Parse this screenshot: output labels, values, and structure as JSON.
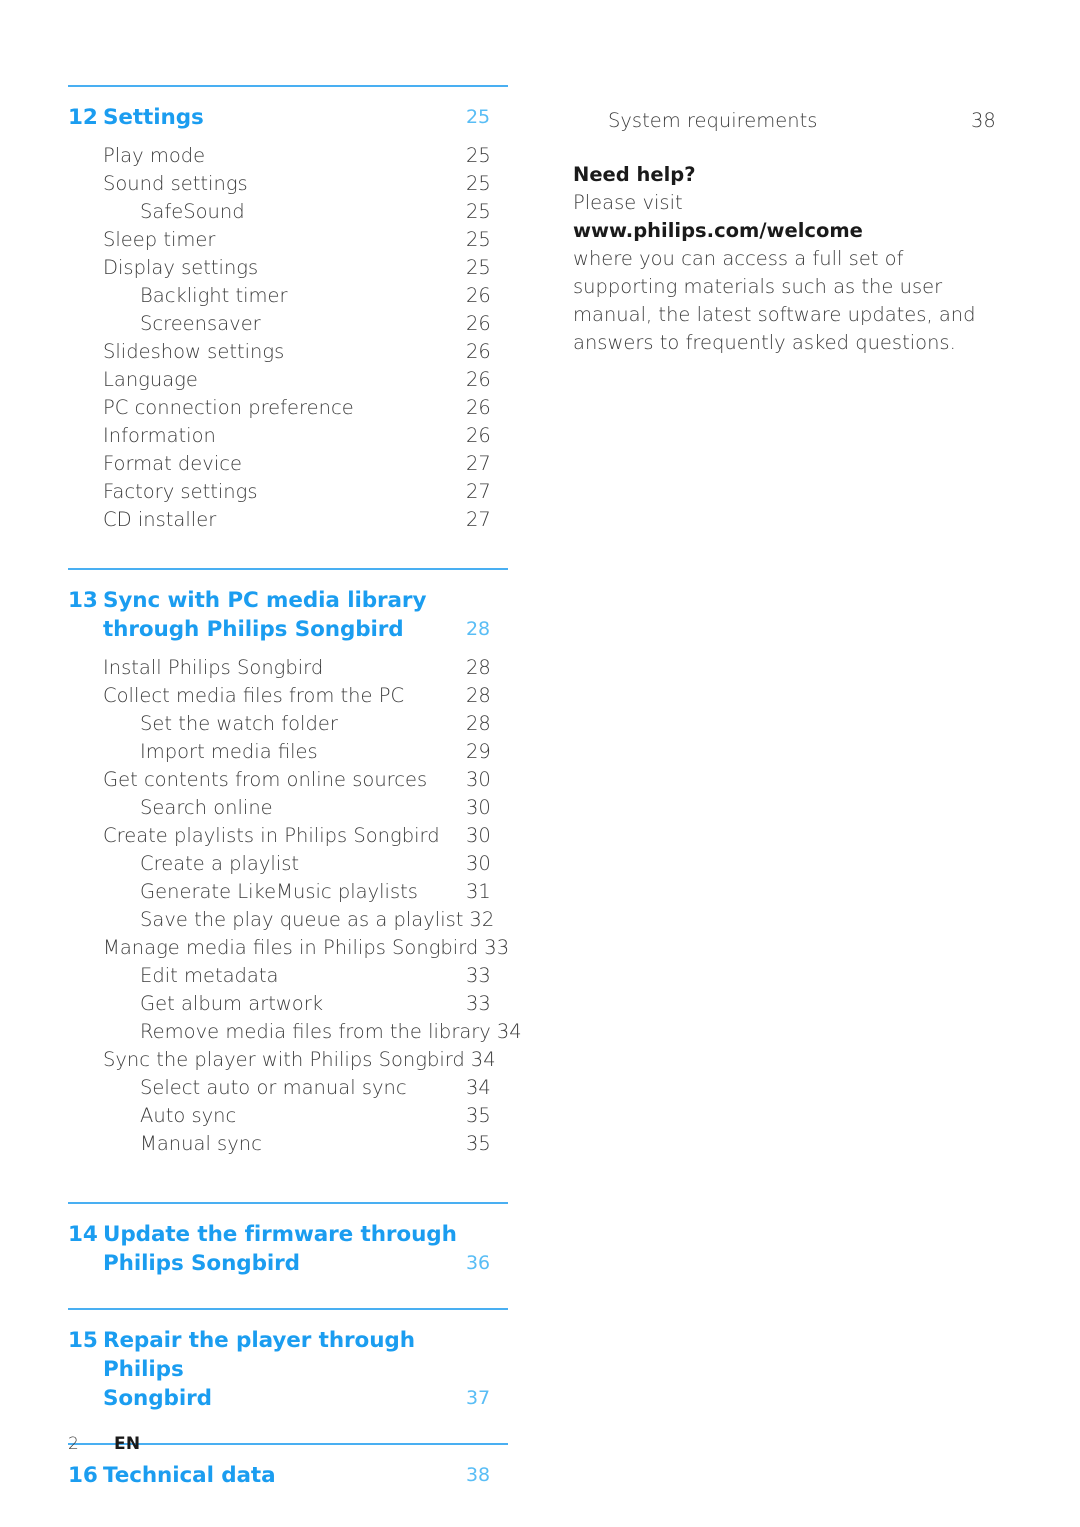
{
  "document": {
    "type": "table-of-contents",
    "language": "EN",
    "page_number": "2"
  },
  "colors": {
    "heading_blue": "#1b9df0",
    "page_number_blue": "#59bdf5",
    "rule_blue": "#49aff2",
    "body_gray": "#3b3b3b"
  },
  "left_column": {
    "sections": [
      {
        "number": "12",
        "title": "Settings",
        "title_line2": "",
        "page": "25",
        "entries": [
          {
            "level": 1,
            "label": "Play mode",
            "page": "25"
          },
          {
            "level": 1,
            "label": "Sound settings",
            "page": "25"
          },
          {
            "level": 2,
            "label": "SafeSound",
            "page": "25"
          },
          {
            "level": 1,
            "label": "Sleep timer",
            "page": "25"
          },
          {
            "level": 1,
            "label": "Display settings",
            "page": "25"
          },
          {
            "level": 2,
            "label": "Backlight timer",
            "page": "26"
          },
          {
            "level": 2,
            "label": "Screensaver",
            "page": "26"
          },
          {
            "level": 1,
            "label": "Slideshow settings",
            "page": "26"
          },
          {
            "level": 1,
            "label": "Language",
            "page": "26"
          },
          {
            "level": 1,
            "label": "PC connection preference",
            "page": "26"
          },
          {
            "level": 1,
            "label": "Information",
            "page": "26"
          },
          {
            "level": 1,
            "label": "Format device",
            "page": "27"
          },
          {
            "level": 1,
            "label": "Factory settings",
            "page": "27"
          },
          {
            "level": 1,
            "label": "CD installer",
            "page": "27"
          }
        ]
      },
      {
        "number": "13",
        "title": "Sync with PC media library",
        "title_line2": "through Philips Songbird",
        "page": "28",
        "entries": [
          {
            "level": 1,
            "label": "Install Philips Songbird",
            "page": "28"
          },
          {
            "level": 1,
            "label": "Collect media files from the PC",
            "page": "28"
          },
          {
            "level": 2,
            "label": "Set the watch folder",
            "page": "28"
          },
          {
            "level": 2,
            "label": "Import media files",
            "page": "29"
          },
          {
            "level": 1,
            "label": "Get contents from online sources",
            "page": "30"
          },
          {
            "level": 2,
            "label": "Search online",
            "page": "30"
          },
          {
            "level": 1,
            "label": "Create playlists in Philips Songbird",
            "page": "30"
          },
          {
            "level": 2,
            "label": "Create a playlist",
            "page": "30"
          },
          {
            "level": 2,
            "label": "Generate LikeMusic playlists",
            "page": "31"
          },
          {
            "level": 2,
            "label": "Save the play queue as a playlist",
            "page": "32"
          },
          {
            "level": 1,
            "label": "Manage media files in Philips Songbird",
            "page": "33"
          },
          {
            "level": 2,
            "label": "Edit metadata",
            "page": "33"
          },
          {
            "level": 2,
            "label": "Get album artwork",
            "page": "33"
          },
          {
            "level": 2,
            "label": "Remove media files from the library",
            "page": "34"
          },
          {
            "level": 1,
            "label": "Sync the player with Philips Songbird",
            "page": "34"
          },
          {
            "level": 2,
            "label": "Select auto or manual sync",
            "page": "34"
          },
          {
            "level": 2,
            "label": "Auto sync",
            "page": "35"
          },
          {
            "level": 2,
            "label": "Manual sync",
            "page": "35"
          }
        ]
      },
      {
        "number": "14",
        "title": "Update the firmware through",
        "title_line2": "Philips Songbird",
        "page": "36",
        "entries": []
      },
      {
        "number": "15",
        "title": "Repair the player through Philips",
        "title_line2": "Songbird",
        "page": "37",
        "entries": []
      },
      {
        "number": "16",
        "title": "Technical data",
        "title_line2": "",
        "page": "38",
        "entries": []
      }
    ]
  },
  "right_column": {
    "entries": [
      {
        "level": 1,
        "label": "System requirements",
        "page": "38"
      }
    ],
    "need_help": {
      "heading": "Need help?",
      "line_visit": "Please visit",
      "url": "www.philips.com/welcome",
      "body": "where you can access a full set of supporting materials such as the user manual, the latest software updates, and answers to frequently asked questions."
    }
  }
}
